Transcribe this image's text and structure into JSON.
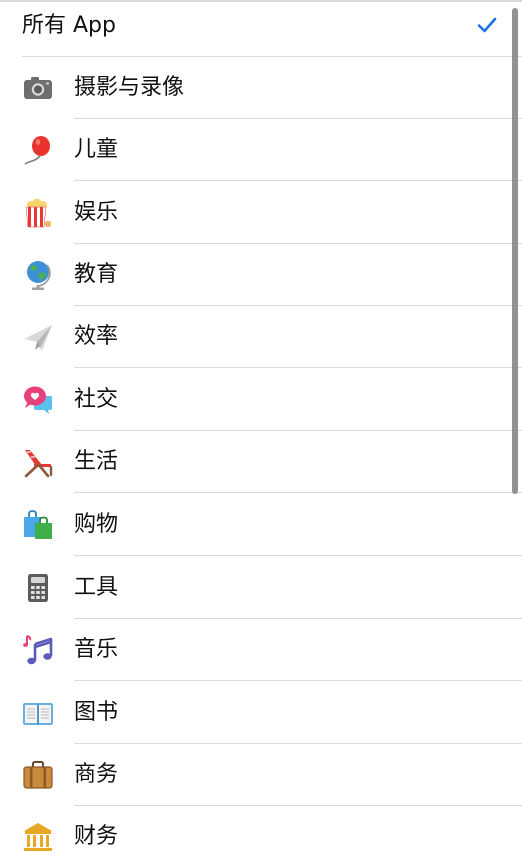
{
  "categories": {
    "all": {
      "label": "所有 App",
      "selected": true,
      "icon": "checkmark-icon"
    },
    "items": [
      {
        "label": "摄影与录像",
        "icon": "camera-icon"
      },
      {
        "label": "儿童",
        "icon": "balloon-icon"
      },
      {
        "label": "娱乐",
        "icon": "popcorn-icon"
      },
      {
        "label": "教育",
        "icon": "globe-icon"
      },
      {
        "label": "效率",
        "icon": "paper-plane-icon"
      },
      {
        "label": "社交",
        "icon": "chat-bubbles-icon"
      },
      {
        "label": "生活",
        "icon": "beach-chair-icon"
      },
      {
        "label": "购物",
        "icon": "shopping-bags-icon"
      },
      {
        "label": "工具",
        "icon": "calculator-icon"
      },
      {
        "label": "音乐",
        "icon": "music-notes-icon"
      },
      {
        "label": "图书",
        "icon": "open-book-icon"
      },
      {
        "label": "商务",
        "icon": "briefcase-icon"
      },
      {
        "label": "财务",
        "icon": "bank-icon"
      }
    ]
  },
  "colors": {
    "accent": "#1a73e8",
    "separator": "#d9d9d9",
    "text": "#111111",
    "scrollbar": "#7f7f7f"
  }
}
